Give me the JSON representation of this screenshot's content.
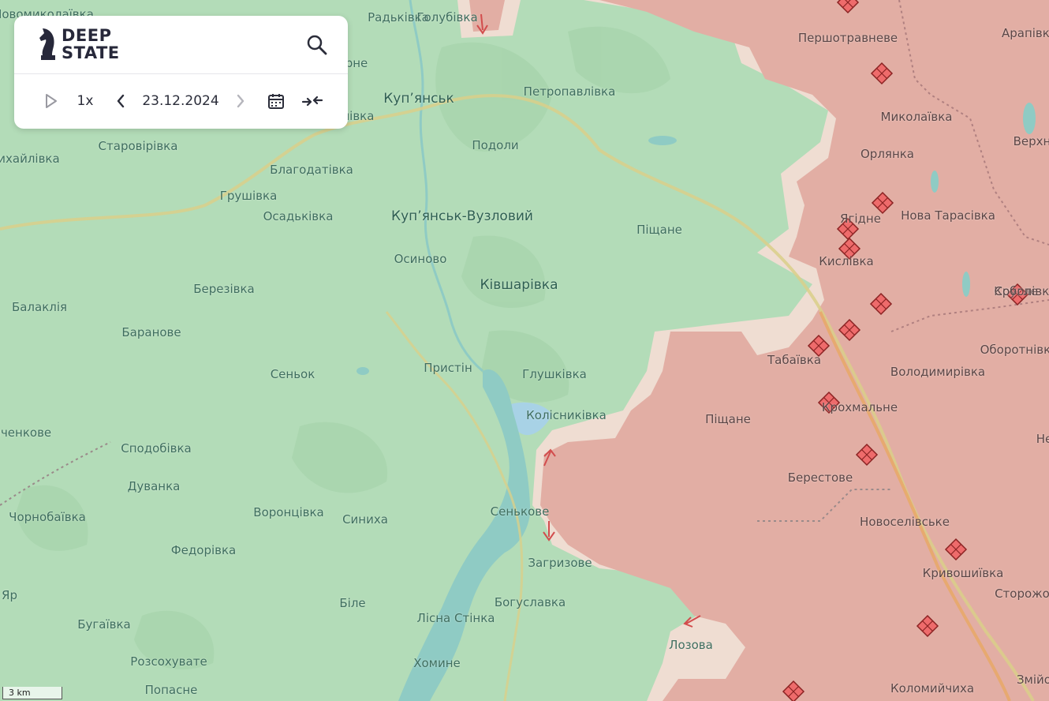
{
  "app": {
    "logo_line1": "DEEP",
    "logo_line2": "STATE"
  },
  "controls": {
    "speed": "1x",
    "date": "23.12.2024"
  },
  "icons": {
    "search": "search-icon",
    "play": "play-icon",
    "prev": "chevron-left-icon",
    "next": "chevron-right-icon",
    "calendar": "calendar-icon",
    "collapse": "collapse-arrows-icon"
  },
  "colors": {
    "ukraine_controlled": "#b3dcb8",
    "occupied": "#e2aea4",
    "grey_zone": "#efddd2",
    "water": "#8fcbc4",
    "front_marker": "#ee6b6b"
  },
  "scale": {
    "label": "3 km"
  },
  "places": [
    {
      "name": "Радьківка"
    },
    {
      "name": "Голубівка"
    },
    {
      "name": "Першотравневе"
    },
    {
      "name": "Арапівка"
    },
    {
      "name": "Новомиколаївка"
    },
    {
      "name": "Петропавлівка"
    },
    {
      "name": "Куп’янськ"
    },
    {
      "name": "Миколаївка"
    },
    {
      "name": "Верхня"
    },
    {
      "name": "Старовірівка"
    },
    {
      "name": "Подоли"
    },
    {
      "name": "Орлянка"
    },
    {
      "name": "Михайлівка"
    },
    {
      "name": "Благодатівка"
    },
    {
      "name": "Грушівка"
    },
    {
      "name": "Осадьківка"
    },
    {
      "name": "Куп’янськ-Вузловий"
    },
    {
      "name": "Ягідне"
    },
    {
      "name": "Нова Тарасівка"
    },
    {
      "name": "Піщане"
    },
    {
      "name": "Кислівка"
    },
    {
      "name": "Кругле"
    },
    {
      "name": "Осиново"
    },
    {
      "name": "Ківшарівка"
    },
    {
      "name": "Березівка"
    },
    {
      "name": "Соболівка"
    },
    {
      "name": "Балаклія"
    },
    {
      "name": "Баранове"
    },
    {
      "name": "Табаївка"
    },
    {
      "name": "Оборотнівка"
    },
    {
      "name": "Пристін"
    },
    {
      "name": "Сеньок"
    },
    {
      "name": "Глушківка"
    },
    {
      "name": "Володимирівка"
    },
    {
      "name": "Колісниківка"
    },
    {
      "name": "Піщане"
    },
    {
      "name": "Крохмальне"
    },
    {
      "name": "Шевченкове"
    },
    {
      "name": "Сподобівка"
    },
    {
      "name": "Дуванка"
    },
    {
      "name": "Берестове"
    },
    {
      "name": "Чорнобаївка"
    },
    {
      "name": "Воронцівка"
    },
    {
      "name": "Синиха"
    },
    {
      "name": "Сеньковe"
    },
    {
      "name": "Новоселівське"
    },
    {
      "name": "Федорівка"
    },
    {
      "name": "Загризове"
    },
    {
      "name": "Кривошиївка"
    },
    {
      "name": "Яр"
    },
    {
      "name": "Біле"
    },
    {
      "name": "Богуславка"
    },
    {
      "name": "Сторожове"
    },
    {
      "name": "Бугаївка"
    },
    {
      "name": "Лісна Стінка"
    },
    {
      "name": "Лозова"
    },
    {
      "name": "Розсохувате"
    },
    {
      "name": "Хомине"
    },
    {
      "name": "Попасне"
    },
    {
      "name": "Коломийчиха"
    },
    {
      "name": "Змійове"
    },
    {
      "name": "Нe"
    },
    {
      "name": "рне"
    },
    {
      "name": "лівка"
    }
  ]
}
